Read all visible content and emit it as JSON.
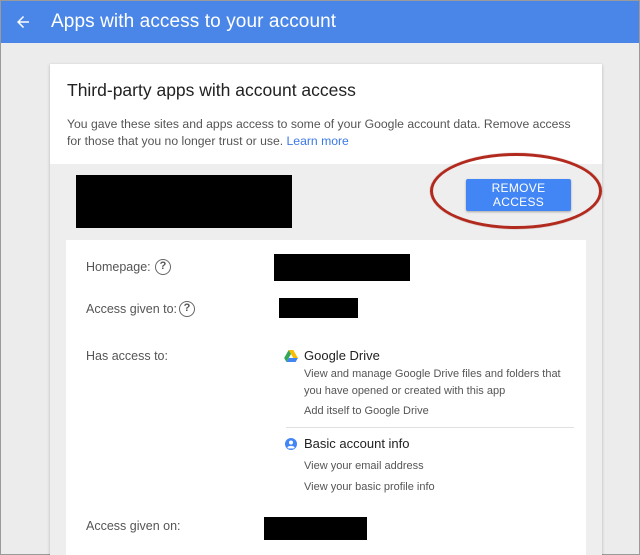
{
  "header": {
    "title": "Apps with access to your account",
    "back_icon": "arrow-back-icon"
  },
  "card": {
    "title": "Third-party apps with account access",
    "description": "You gave these sites and apps access to some of your Google account data. Remove access for those that you no longer trust or use.",
    "learn_more": "Learn more"
  },
  "app": {
    "remove_label": "REMOVE ACCESS",
    "homepage_label": "Homepage:",
    "access_given_to_label": "Access given to:",
    "has_access_label": "Has access to:",
    "access_given_on_label": "Access given on:",
    "help_icon": "?",
    "services": [
      {
        "icon": "google-drive-icon",
        "name": "Google Drive",
        "details": [
          "View and manage Google Drive files and folders that you have opened or created with this app",
          "Add itself to Google Drive"
        ]
      },
      {
        "icon": "account-info-icon",
        "name": "Basic account info",
        "details": [
          "View your email address",
          "View your basic profile info"
        ]
      }
    ]
  },
  "colors": {
    "topbar": "#4a86e8",
    "button": "#4285f4",
    "annotation": "#b22a1e",
    "link": "#3b78e7"
  }
}
